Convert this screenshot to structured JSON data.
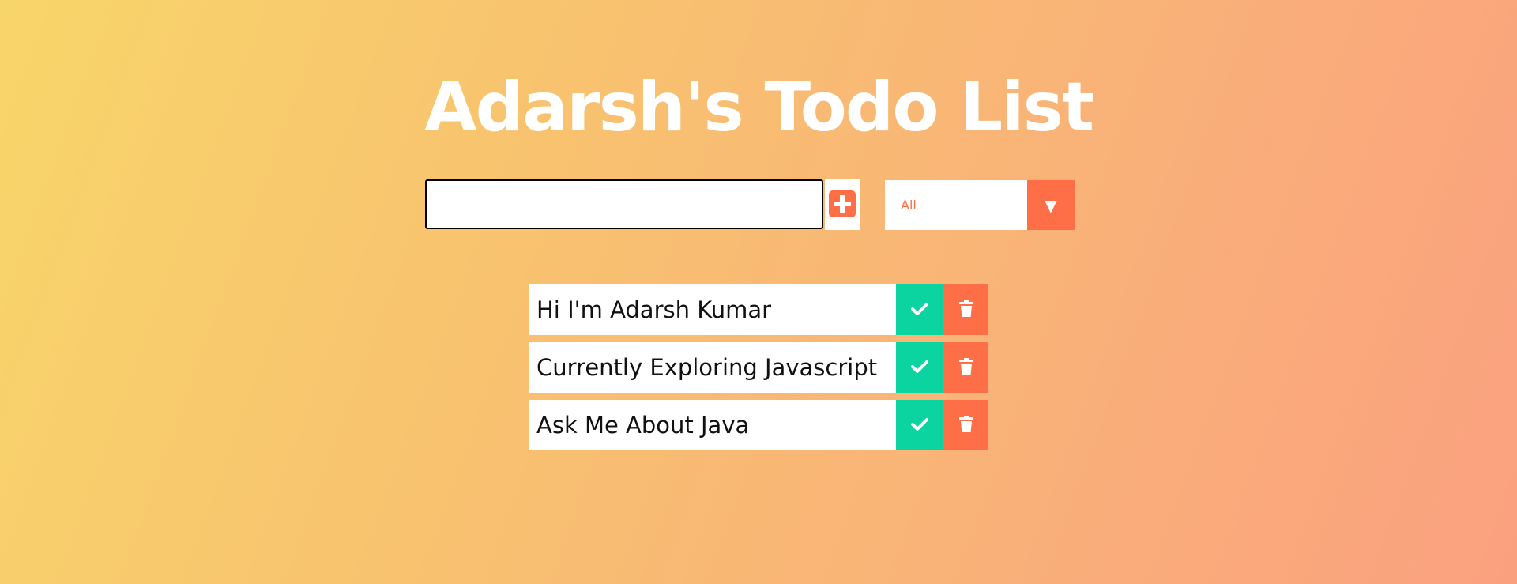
{
  "header": {
    "title": "Adarsh's Todo List"
  },
  "form": {
    "input_value": "",
    "add_icon": "plus-square-icon",
    "filter_selected": "All",
    "filter_arrow": "▼"
  },
  "todos": [
    {
      "text": "Hi I'm Adarsh Kumar"
    },
    {
      "text": "Currently Exploring Javascript"
    },
    {
      "text": "Ask Me About Java"
    }
  ],
  "colors": {
    "accent": "#ff6f47",
    "complete": "#0cd4a0",
    "background_start": "#f8d56a",
    "background_end": "#fba07f"
  }
}
